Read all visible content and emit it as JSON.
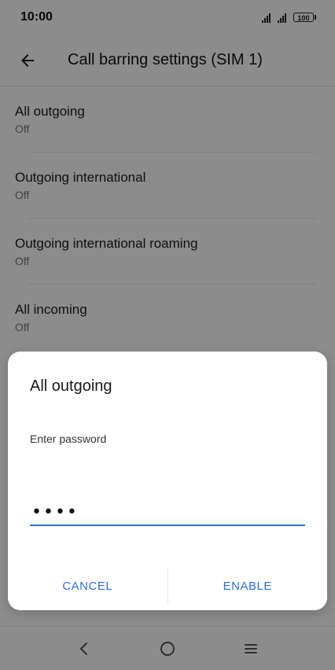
{
  "status_bar": {
    "time": "10:00",
    "battery": "100"
  },
  "app_bar": {
    "title": "Call barring settings (SIM 1)",
    "back_icon": "arrow-back-icon"
  },
  "settings": [
    {
      "title": "All outgoing",
      "value": "Off"
    },
    {
      "title": "Outgoing international",
      "value": "Off"
    },
    {
      "title": "Outgoing international roaming",
      "value": "Off"
    },
    {
      "title": "All incoming",
      "value": "Off"
    }
  ],
  "dialog": {
    "title": "All outgoing",
    "label": "Enter password",
    "password_value": "1234",
    "cancel_label": "CANCEL",
    "enable_label": "ENABLE"
  },
  "navigation": {
    "back_icon": "back-icon",
    "home_icon": "home-icon",
    "menu_icon": "menu-icon"
  },
  "colors": {
    "accent": "#2f6fd6",
    "scrim": "#000000"
  }
}
